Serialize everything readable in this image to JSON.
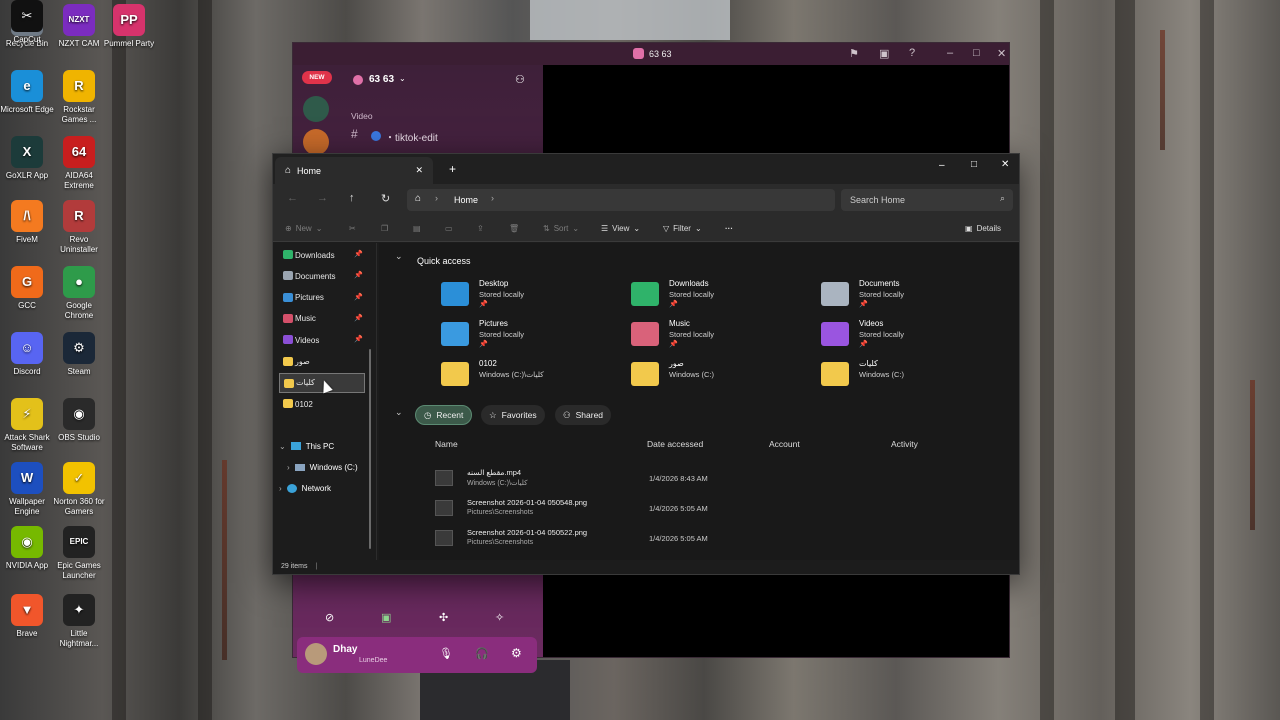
{
  "desktop_icons": [
    {
      "label": "Recycle Bin",
      "icon": "recycle-bin-icon",
      "color": "#6f7a86",
      "glyph": "♻"
    },
    {
      "label": "NZXT CAM",
      "icon": "nzxt-cam-icon",
      "color": "#7b2cbf",
      "glyph": "NZXT"
    },
    {
      "label": "Pummel Party",
      "icon": "pummel-party-icon",
      "color": "#d6336c",
      "glyph": "PP"
    },
    {
      "label": "Microsoft Edge",
      "icon": "edge-icon",
      "color": "#1a8fd8",
      "glyph": "e"
    },
    {
      "label": "Rockstar Games ...",
      "icon": "rockstar-icon",
      "color": "#f0b400",
      "glyph": "R"
    },
    {
      "label": "GoXLR App",
      "icon": "goxlr-icon",
      "color": "#1c3b3a",
      "glyph": "X"
    },
    {
      "label": "AIDA64 Extreme",
      "icon": "aida64-icon",
      "color": "#c81e1e",
      "glyph": "64"
    },
    {
      "label": "FiveM",
      "icon": "fivem-icon",
      "color": "#f47a20",
      "glyph": "/\\"
    },
    {
      "label": "Revo Uninstaller",
      "icon": "revo-icon",
      "color": "#b23b3b",
      "glyph": "R"
    },
    {
      "label": "GCC",
      "icon": "gcc-icon",
      "color": "#f06a1a",
      "glyph": "G"
    },
    {
      "label": "Google Chrome",
      "icon": "chrome-icon",
      "color": "#2e9b4a",
      "glyph": "●"
    },
    {
      "label": "Discord",
      "icon": "discord-icon",
      "color": "#5865f2",
      "glyph": "☺"
    },
    {
      "label": "Steam",
      "icon": "steam-icon",
      "color": "#1b2838",
      "glyph": "⚙"
    },
    {
      "label": "Attack Shark Software",
      "icon": "attack-shark-icon",
      "color": "#e3c11a",
      "glyph": "⚡"
    },
    {
      "label": "OBS Studio",
      "icon": "obs-icon",
      "color": "#2a2a2a",
      "glyph": "◉"
    },
    {
      "label": "Wallpaper Engine",
      "icon": "wallpaper-engine-icon",
      "color": "#1d4fbf",
      "glyph": "W"
    },
    {
      "label": "Norton 360 for Gamers",
      "icon": "norton-icon",
      "color": "#f2c200",
      "glyph": "✓"
    },
    {
      "label": "NVIDIA App",
      "icon": "nvidia-icon",
      "color": "#76b900",
      "glyph": "◉"
    },
    {
      "label": "Epic Games Launcher",
      "icon": "epic-games-icon",
      "color": "#222222",
      "glyph": "EPIC"
    },
    {
      "label": "Brave",
      "icon": "brave-icon",
      "color": "#f1562b",
      "glyph": "▼"
    },
    {
      "label": "Little Nightmar...",
      "icon": "little-nightmares-icon",
      "color": "#222222",
      "glyph": "✦"
    },
    {
      "label": "CapCut",
      "icon": "capcut-icon",
      "color": "#111111",
      "glyph": "✂"
    }
  ],
  "discord": {
    "title": "63 63",
    "server_name": "63 63",
    "new_badge": "NEW",
    "category": "Video",
    "channel": "・tiktok-edit",
    "user": {
      "name": "Dhay",
      "status": "LuneDee"
    },
    "accent": "#c02a9a"
  },
  "explorer": {
    "tab_label": "Home",
    "breadcrumb": "Home",
    "search_placeholder": "Search Home",
    "commands": {
      "new": "New",
      "sort": "Sort",
      "view": "View",
      "filter": "Filter",
      "more": "···",
      "details": "Details"
    },
    "nav": [
      {
        "label": "Downloads",
        "pinned": true,
        "color": "#2fb36a"
      },
      {
        "label": "Documents",
        "pinned": true,
        "color": "#9aa5b1"
      },
      {
        "label": "Pictures",
        "pinned": true,
        "color": "#3a8fd6"
      },
      {
        "label": "Music",
        "pinned": true,
        "color": "#d4506a"
      },
      {
        "label": "Videos",
        "pinned": true,
        "color": "#8b4fd6"
      },
      {
        "label": "صور",
        "pinned": false,
        "color": "#f2c94c"
      },
      {
        "label": "كليات",
        "pinned": false,
        "color": "#f2c94c",
        "selected": true
      },
      {
        "label": "0102",
        "pinned": false,
        "color": "#f2c94c"
      }
    ],
    "tree": {
      "this_pc": "This PC",
      "drive": "Windows (C:)",
      "network": "Network"
    },
    "quick_access": {
      "heading": "Quick access",
      "tiles": [
        {
          "name": "Desktop",
          "sub": "Stored locally",
          "color": "#2b8fd8",
          "pinned": true
        },
        {
          "name": "Downloads",
          "sub": "Stored locally",
          "color": "#2fb36a",
          "pinned": true
        },
        {
          "name": "Documents",
          "sub": "Stored locally",
          "color": "#aab4c0",
          "pinned": true
        },
        {
          "name": "Pictures",
          "sub": "Stored locally",
          "color": "#3a9ae0",
          "pinned": true
        },
        {
          "name": "Music",
          "sub": "Stored locally",
          "color": "#d9627a",
          "pinned": true
        },
        {
          "name": "Videos",
          "sub": "Stored locally",
          "color": "#9a55e0",
          "pinned": true
        },
        {
          "name": "0102",
          "sub": "Windows (C:)\\كليات",
          "color": "#f2c94c",
          "pinned": false
        },
        {
          "name": "صور",
          "sub": "Windows (C:)",
          "color": "#f2c94c",
          "pinned": false
        },
        {
          "name": "كليات",
          "sub": "Windows (C:)",
          "color": "#f2c94c",
          "pinned": false
        }
      ]
    },
    "filters": {
      "recent": "Recent",
      "favorites": "Favorites",
      "shared": "Shared"
    },
    "columns": {
      "name": "Name",
      "date": "Date accessed",
      "account": "Account",
      "activity": "Activity"
    },
    "recent": [
      {
        "name": "مقطع السنه.mp4",
        "path": "Windows (C:)\\كليات",
        "date": "1/4/2026 8:43 AM"
      },
      {
        "name": "Screenshot 2026-01-04 050548.png",
        "path": "Pictures\\Screenshots",
        "date": "1/4/2026 5:05 AM"
      },
      {
        "name": "Screenshot 2026-01-04 050522.png",
        "path": "Pictures\\Screenshots",
        "date": "1/4/2026 5:05 AM"
      }
    ],
    "status": "29 items"
  }
}
